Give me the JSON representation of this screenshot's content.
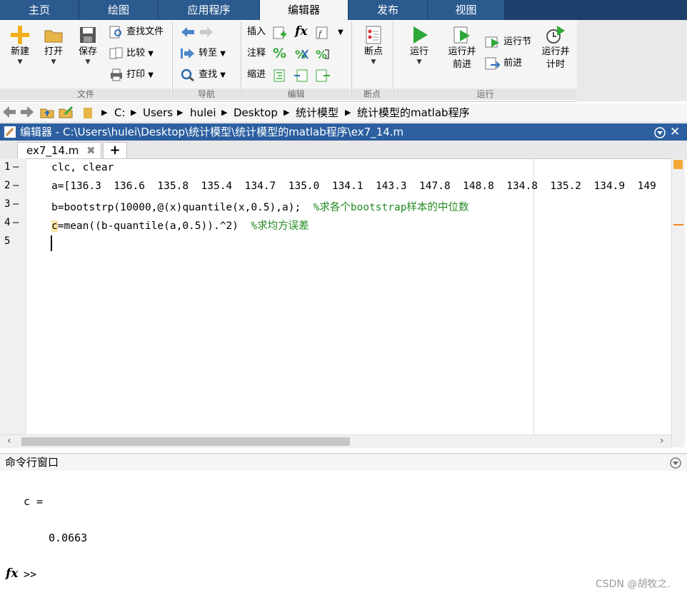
{
  "tabs": [
    "主页",
    "绘图",
    "应用程序",
    "编辑器",
    "发布",
    "视图"
  ],
  "ribbon": {
    "file": {
      "new": "新建",
      "open": "打开",
      "save": "保存",
      "find_files": "查找文件",
      "compare": "比较",
      "print": "打印",
      "group": "文件"
    },
    "nav": {
      "goto": "转至",
      "find": "查找",
      "group": "导航"
    },
    "edit": {
      "insert": "插入",
      "comment": "注释",
      "indent": "缩进",
      "fx": "fx",
      "group": "编辑"
    },
    "breakpoints": {
      "label": "断点",
      "group": "断点"
    },
    "run": {
      "run": "运行",
      "run_advance": "运行并\n前进",
      "run_section": "运行节",
      "advance": "前进",
      "run_time": "运行并\n计时",
      "group": "运行"
    }
  },
  "address": {
    "crumbs": [
      "C:",
      "Users",
      "hulei",
      "Desktop",
      "统计模型",
      "统计模型的matlab程序"
    ]
  },
  "editor": {
    "title": "编辑器 - C:\\Users\\hulei\\Desktop\\统计模型\\统计模型的matlab程序\\ex7_14.m",
    "file_tab": "ex7_14.m",
    "add_tab": "+",
    "line_numbers": [
      "1",
      "2",
      "3",
      "4",
      "5"
    ],
    "dashes": [
      "—",
      "—",
      "—",
      "—",
      ""
    ],
    "lines": {
      "l1": "clc, clear",
      "l2": "a=[136.3  136.6  135.8  135.4  134.7  135.0  134.1  143.3  147.8  148.8  134.8  135.2  134.9  149",
      "l3_code": "b=bootstrp(10000,@(x)quantile(x,0.5),a);  ",
      "l3_comment": "%求各个bootstrap样本的中位数",
      "l4_code_a": "c",
      "l4_code_b": "=mean((b-quantile(a,0.5)).^2)  ",
      "l4_comment": "%求均方误差"
    }
  },
  "command": {
    "title": "命令行窗口",
    "output_var": "c =",
    "output_val": "0.0663",
    "prompt": ">>",
    "fx": "fx"
  },
  "watermark": "CSDN @胡牧之.",
  "colors": {
    "accent_blue": "#2b5fa0",
    "tab_bar": "#1d3f6b",
    "comment_green": "#228b22"
  }
}
